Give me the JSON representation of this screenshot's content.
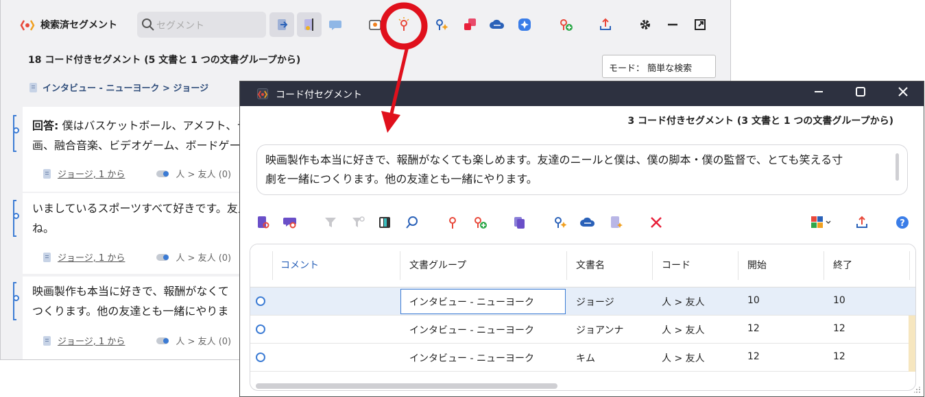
{
  "app": {
    "title": "検索済セグメント",
    "search_placeholder": "セグメント",
    "count_text": "18 コード付きセグメント (5 文書と 1 つの文書グループから)",
    "mode_label": "モード： 簡単な検索",
    "breadcrumb": "インタビュー - ニューヨーク > ジョージ"
  },
  "segments": [
    {
      "lines": [
        "回答: 僕はバスケットボール、アメフト、テ",
        "画、融合音楽、ビデオゲーム、ボードゲー"
      ],
      "bold_prefix": "回答:",
      "doc": "ジョージ, 1 から",
      "code": "人 > 友人 (0)"
    },
    {
      "lines": [
        "いましているスポーツすべて好きです。友人",
        "ね。"
      ],
      "doc": "ジョージ, 1 から",
      "code": "人 > 友人 (0)"
    },
    {
      "lines": [
        "映画製作も本当に好きで、報酬がなくて",
        "つくります。他の友達とも一緒にやりま"
      ],
      "doc": "ジョージ, 1 から",
      "code": "人 > 友人 (0)"
    }
  ],
  "dialog": {
    "title": "コード付セグメント",
    "count_text": "3 コード付きセグメント (3 文書と 1 つの文書グループから)",
    "quote_lines": [
      "映画製作も本当に好きで、報酬がなくても楽しめます。友達のニールと僕は、僕の脚本・僕の監督で、とても笑える寸",
      "劇を一緒につくります。他の友達とも一緒にやります。"
    ],
    "columns": [
      "コメント",
      "文書グループ",
      "文書名",
      "コード",
      "開始",
      "終了"
    ],
    "rows": [
      {
        "comment": "",
        "group": "インタビュー - ニューヨーク",
        "doc": "ジョージ",
        "code": "人 > 友人",
        "start": "10",
        "end": "10"
      },
      {
        "comment": "",
        "group": "インタビュー - ニューヨーク",
        "doc": "ジョアンナ",
        "code": "人 > 友人",
        "start": "12",
        "end": "12"
      },
      {
        "comment": "",
        "group": "インタビュー - ニューヨーク",
        "doc": "キム",
        "code": "人 > 友人",
        "start": "12",
        "end": "12"
      }
    ]
  },
  "colors": {
    "accent_blue": "#3b7bd4",
    "annotation_red": "#e0101c",
    "dialog_titlebar": "#2d3140"
  },
  "icons": {
    "bg_toolbar": [
      "search-icon",
      "export-to-document-icon",
      "edit-text-icon",
      "comment-icon",
      "show-document-icon",
      "code-highlight-icon",
      "ai-assist-icon",
      "color-squares-icon",
      "cloud-icon",
      "ai-star-icon",
      "add-code-icon",
      "upload-icon",
      "gear-icon",
      "minimize-icon",
      "popout-icon"
    ],
    "dialog_toolbar": [
      "document-code-icon",
      "comment-code-icon",
      "filter-icon",
      "filter-settings-icon",
      "columns-icon",
      "search-icon",
      "code-icon",
      "add-code-icon",
      "copy-icon",
      "ai-assist-icon",
      "cloud-icon",
      "document-star-icon",
      "delete-icon",
      "colors-menu-icon",
      "export-icon",
      "help-icon"
    ]
  }
}
